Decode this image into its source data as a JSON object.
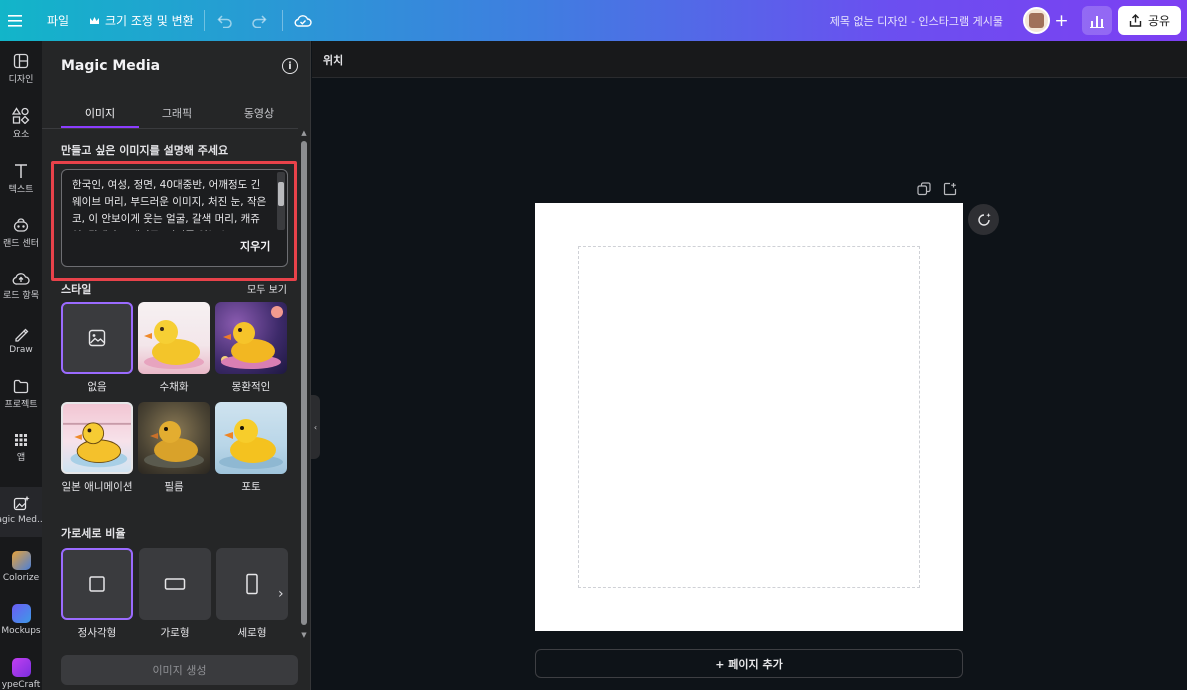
{
  "topbar": {
    "menu_icon": "hamburger-icon",
    "file_label": "파일",
    "resize_label": "크기 조정 및 변환",
    "resize_icon": "crown-icon",
    "design_title": "제목 없는 디자인 - 인스타그램 게시물",
    "share_label": "공유"
  },
  "rail": {
    "items": [
      {
        "label": "디자인",
        "icon": "layout-icon"
      },
      {
        "label": "요소",
        "icon": "shapes-icon"
      },
      {
        "label": "텍스트",
        "icon": "text-icon"
      },
      {
        "label": "랜드 센터",
        "icon": "brand-icon"
      },
      {
        "label": "로드 항목",
        "icon": "upload-icon"
      },
      {
        "label": "Draw",
        "icon": "draw-icon"
      },
      {
        "label": "프로젝트",
        "icon": "folder-icon"
      },
      {
        "label": "앱",
        "icon": "apps-icon"
      },
      {
        "label": "agic Med...",
        "icon": "magic-media-icon"
      },
      {
        "label": "Colorize",
        "icon": "colorize-icon"
      },
      {
        "label": "Mockups",
        "icon": "mockups-icon"
      },
      {
        "label": "ypeCraft",
        "icon": "typecraft-icon"
      }
    ]
  },
  "panel": {
    "title": "Magic Media",
    "tabs": [
      {
        "label": "이미지"
      },
      {
        "label": "그래픽"
      },
      {
        "label": "동영상"
      }
    ],
    "prompt_label": "만들고 싶은 이미지를 설명해 주세요",
    "prompt_text": "한국인, 여성, 정면, 40대중반, 어깨정도 긴 웨이브 머리, 부드러운 이미지, 처진 눈, 작은 코, 이 안보이게 웃는 얼굴, 갈색 머리, 캐쥬얼, 갈색과 오렌지톤, 쌍꺼풀 없는 눈",
    "clear_label": "지우기",
    "style_label": "스타일",
    "see_all_label": "모두 보기",
    "styles": [
      {
        "label": "없음"
      },
      {
        "label": "수채화"
      },
      {
        "label": "몽환적인"
      },
      {
        "label": "일본 애니메이션"
      },
      {
        "label": "필름"
      },
      {
        "label": "포토"
      }
    ],
    "ratio_label": "가로세로 비율",
    "ratios": [
      {
        "label": "정사각형"
      },
      {
        "label": "가로형"
      },
      {
        "label": "세로형"
      }
    ],
    "generate_label": "이미지 생성"
  },
  "main": {
    "position_label": "위치",
    "add_page_label": "+ 페이지 추가"
  },
  "colors": {
    "accent": "#8b3dff",
    "highlight_frame": "#e8424a",
    "panel_bg": "#252627",
    "canvas_bg": "#0e1318"
  }
}
